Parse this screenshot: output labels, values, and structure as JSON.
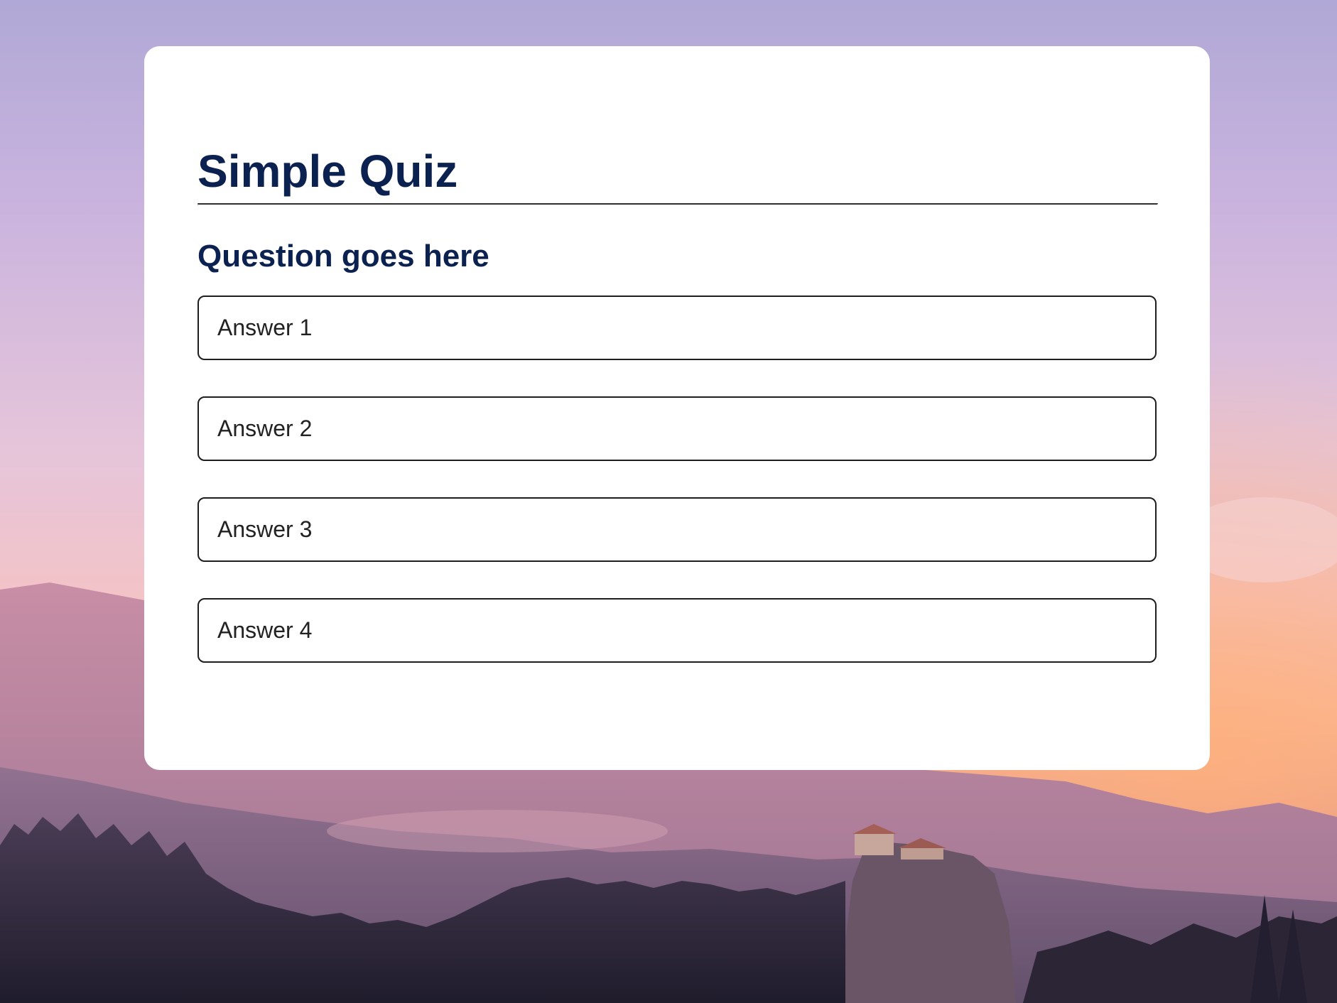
{
  "quiz": {
    "title": "Simple Quiz",
    "question": "Question goes here",
    "answers": [
      {
        "label": "Answer 1"
      },
      {
        "label": "Answer 2"
      },
      {
        "label": "Answer 3"
      },
      {
        "label": "Answer 4"
      }
    ]
  },
  "colors": {
    "heading": "#0b2150",
    "card": "#ffffff",
    "answer_border": "#1e1e1e"
  }
}
